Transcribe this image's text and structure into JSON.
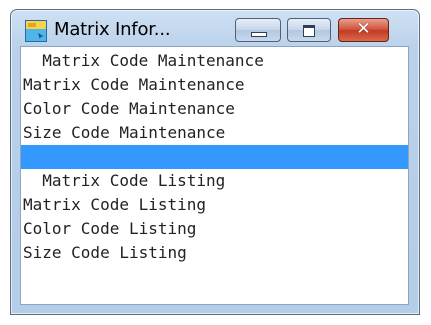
{
  "window": {
    "title": "Matrix Infor...",
    "controls": {
      "minimize": "minimize",
      "maximize": "maximize",
      "close": "✕"
    }
  },
  "list": {
    "selected_index": 4,
    "selection_color": "#3399ff",
    "items": [
      "  Matrix Code Maintenance",
      "Matrix Code Maintenance",
      "Color Code Maintenance",
      "Size Code Maintenance",
      "",
      "  Matrix Code Listing",
      "Matrix Code Listing",
      "Color Code Listing",
      "Size Code Listing"
    ]
  }
}
